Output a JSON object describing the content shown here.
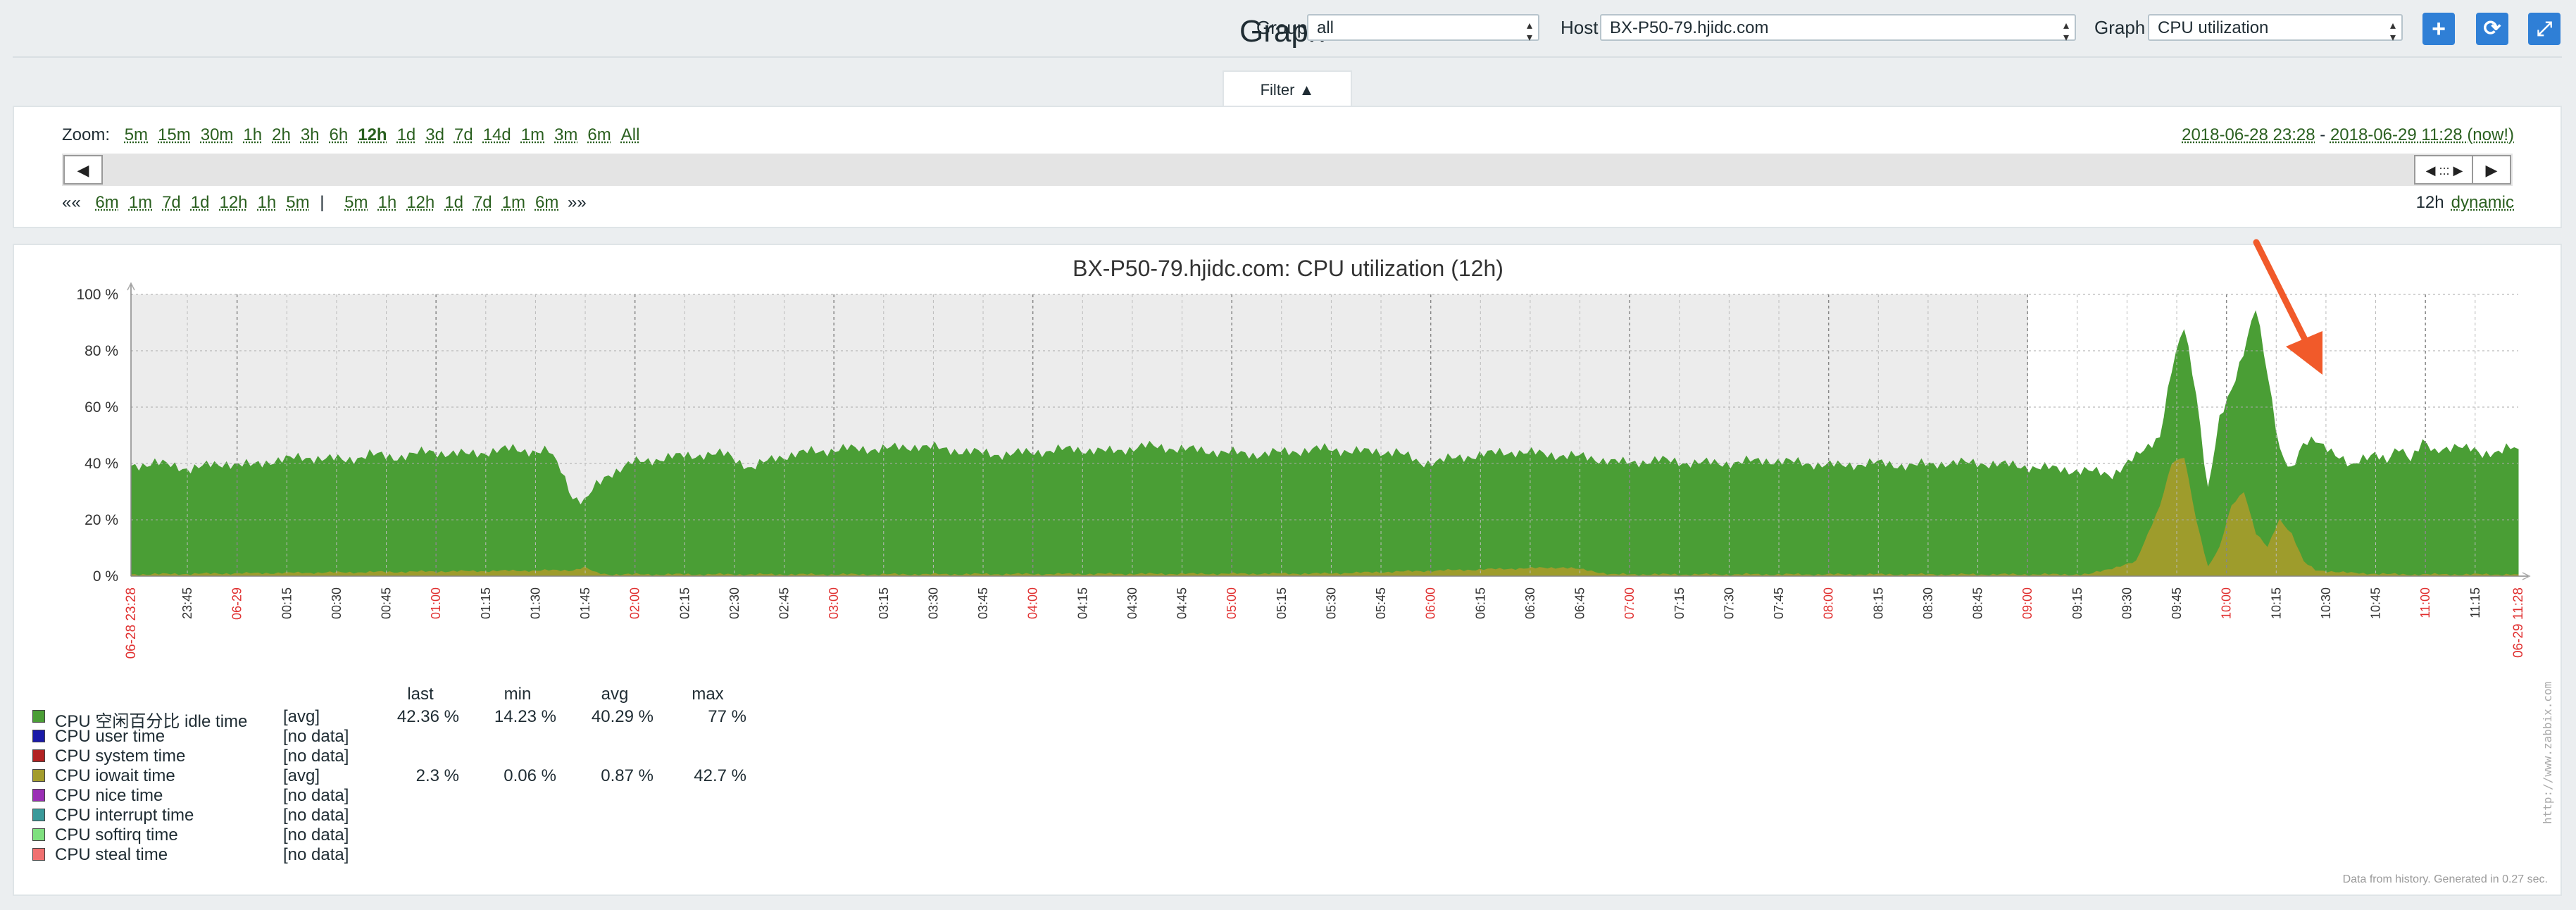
{
  "header": {
    "title": "Graph",
    "group_label": "Group",
    "group_value": "all",
    "host_label": "Host",
    "host_value": "BX-P50-79.hjidc.com",
    "graph_label": "Graph",
    "graph_value": "CPU utilization"
  },
  "filter": {
    "tab_label": "Filter ▲",
    "zoom_label": "Zoom:",
    "zoom_options": [
      "5m",
      "15m",
      "30m",
      "1h",
      "2h",
      "3h",
      "6h",
      "12h",
      "1d",
      "3d",
      "7d",
      "14d",
      "1m",
      "3m",
      "6m",
      "All"
    ],
    "zoom_active": "12h",
    "period_from": "2018-06-28 23:28",
    "period_sep": " - ",
    "period_to": "2018-06-29 11:28 (now!)",
    "nav_back_label": "««",
    "nav_back_options": [
      "6m",
      "1m",
      "7d",
      "1d",
      "12h",
      "1h",
      "5m"
    ],
    "nav_separator": "|",
    "nav_fwd_options": [
      "5m",
      "1h",
      "12h",
      "1d",
      "7d",
      "1m",
      "6m"
    ],
    "nav_fwd_label": "»»",
    "period_length": "12h",
    "period_mode": "dynamic",
    "scroll_left_label": "◀",
    "scroll_right_label": "▶",
    "scroll_handle_label": "◀ ::: ▶"
  },
  "chart_data": {
    "type": "area",
    "title": "BX-P50-79.hjidc.com: CPU utilization (12h)",
    "ylim": [
      0,
      100
    ],
    "y_ticks": [
      "100 %",
      "80 %",
      "60 %",
      "40 %",
      "20 %",
      "0 %"
    ],
    "x_start_label": "06-28 23:28",
    "x_end_label": "06-29 11:28",
    "x_tick_labels": [
      "23:45",
      "06-29",
      "00:15",
      "00:30",
      "00:45",
      "01:00",
      "01:15",
      "01:30",
      "01:45",
      "02:00",
      "02:15",
      "02:30",
      "02:45",
      "03:00",
      "03:15",
      "03:30",
      "03:45",
      "04:00",
      "04:15",
      "04:30",
      "04:45",
      "05:00",
      "05:15",
      "05:30",
      "05:45",
      "06:00",
      "06:15",
      "06:30",
      "06:45",
      "07:00",
      "07:15",
      "07:30",
      "07:45",
      "08:00",
      "08:15",
      "08:30",
      "08:45",
      "09:00",
      "09:15",
      "09:30",
      "09:45",
      "10:00",
      "10:15",
      "10:30",
      "10:45",
      "11:00",
      "11:15"
    ],
    "x_tick_red": [
      "06-29",
      "01:00",
      "02:00",
      "03:00",
      "04:00",
      "05:00",
      "06:00",
      "07:00",
      "08:00",
      "09:00",
      "10:00",
      "11:00"
    ],
    "series": [
      {
        "name": "CPU 空闲百分比 idle time",
        "color": "#4a9e35",
        "points": [
          [
            0,
            39
          ],
          [
            2,
            40
          ],
          [
            5,
            38
          ],
          [
            8,
            40
          ],
          [
            10,
            39
          ],
          [
            12,
            41
          ],
          [
            15,
            42
          ],
          [
            18,
            41
          ],
          [
            20,
            43
          ],
          [
            22,
            42
          ],
          [
            25,
            44
          ],
          [
            28,
            43
          ],
          [
            30,
            44
          ],
          [
            32,
            45
          ],
          [
            34,
            44
          ],
          [
            35,
            44
          ],
          [
            36,
            38
          ],
          [
            37,
            28
          ],
          [
            38,
            26
          ],
          [
            39,
            32
          ],
          [
            40,
            36
          ],
          [
            42,
            40
          ],
          [
            45,
            42
          ],
          [
            48,
            43
          ],
          [
            50,
            43
          ],
          [
            52,
            38
          ],
          [
            54,
            42
          ],
          [
            57,
            44
          ],
          [
            60,
            45
          ],
          [
            63,
            45
          ],
          [
            66,
            46
          ],
          [
            70,
            44
          ],
          [
            73,
            43
          ],
          [
            76,
            44
          ],
          [
            79,
            45
          ],
          [
            82,
            44
          ],
          [
            85,
            46
          ],
          [
            88,
            45
          ],
          [
            91,
            44
          ],
          [
            94,
            43
          ],
          [
            97,
            44
          ],
          [
            100,
            45
          ],
          [
            103,
            44
          ],
          [
            106,
            44
          ],
          [
            108,
            40
          ],
          [
            110,
            41
          ],
          [
            113,
            43
          ],
          [
            116,
            44
          ],
          [
            119,
            43
          ],
          [
            122,
            42
          ],
          [
            125,
            40
          ],
          [
            128,
            41
          ],
          [
            131,
            40
          ],
          [
            134,
            40
          ],
          [
            137,
            41
          ],
          [
            140,
            40
          ],
          [
            143,
            39
          ],
          [
            146,
            40
          ],
          [
            149,
            39
          ],
          [
            152,
            40
          ],
          [
            155,
            40
          ],
          [
            158,
            39
          ],
          [
            161,
            38
          ],
          [
            164,
            37
          ],
          [
            166,
            36
          ],
          [
            168,
            42
          ],
          [
            170,
            50
          ],
          [
            171,
            73
          ],
          [
            172,
            88
          ],
          [
            173,
            65
          ],
          [
            174,
            30
          ],
          [
            175,
            55
          ],
          [
            176,
            66
          ],
          [
            177,
            80
          ],
          [
            178,
            95
          ],
          [
            179,
            70
          ],
          [
            180,
            45
          ],
          [
            181,
            38
          ],
          [
            182,
            46
          ],
          [
            183,
            48
          ],
          [
            184,
            46
          ],
          [
            185,
            42
          ],
          [
            186,
            38
          ],
          [
            187,
            42
          ],
          [
            188,
            44
          ],
          [
            189,
            40
          ],
          [
            190,
            45
          ],
          [
            191,
            42
          ],
          [
            192,
            48
          ],
          [
            193,
            43
          ],
          [
            194,
            45
          ],
          [
            195,
            47
          ],
          [
            196,
            45
          ],
          [
            197,
            42
          ],
          [
            198,
            44
          ],
          [
            199,
            46
          ],
          [
            200,
            45
          ]
        ]
      },
      {
        "name": "CPU iowait time",
        "color": "#a39c2c",
        "points": [
          [
            0,
            0.5
          ],
          [
            37,
            2
          ],
          [
            38,
            3
          ],
          [
            39,
            1
          ],
          [
            40,
            0.5
          ],
          [
            60,
            0.5
          ],
          [
            100,
            0.8
          ],
          [
            120,
            3
          ],
          [
            122,
            2
          ],
          [
            124,
            0.5
          ],
          [
            164,
            0.5
          ],
          [
            168,
            5
          ],
          [
            170,
            25
          ],
          [
            171,
            40
          ],
          [
            172,
            42
          ],
          [
            173,
            20
          ],
          [
            174,
            3
          ],
          [
            175,
            10
          ],
          [
            176,
            25
          ],
          [
            177,
            30
          ],
          [
            178,
            15
          ],
          [
            179,
            10
          ],
          [
            180,
            20
          ],
          [
            181,
            15
          ],
          [
            182,
            5
          ],
          [
            183,
            2
          ],
          [
            186,
            1
          ],
          [
            190,
            0.5
          ],
          [
            200,
            0.5
          ]
        ]
      }
    ]
  },
  "legend": {
    "headers": {
      "last": "last",
      "min": "min",
      "avg": "avg",
      "max": "max"
    },
    "items": [
      {
        "name": "CPU 空闲百分比 idle time",
        "func": "[avg]",
        "last": "42.36 %",
        "min": "14.23 %",
        "avg": "40.29 %",
        "max": "77 %",
        "color": "#4a9e35"
      },
      {
        "name": "CPU user time",
        "func": "[no data]",
        "color": "#1a1aa8"
      },
      {
        "name": "CPU system time",
        "func": "[no data]",
        "color": "#b22222"
      },
      {
        "name": "CPU iowait time",
        "func": "[avg]",
        "last": "2.3 %",
        "min": "0.06 %",
        "avg": "0.87 %",
        "max": "42.7 %",
        "color": "#a39c2c"
      },
      {
        "name": "CPU nice time",
        "func": "[no data]",
        "color": "#9b2fb5"
      },
      {
        "name": "CPU interrupt time",
        "func": "[no data]",
        "color": "#3a9a9a"
      },
      {
        "name": "CPU softirq time",
        "func": "[no data]",
        "color": "#7fe07f"
      },
      {
        "name": "CPU steal time",
        "func": "[no data]",
        "color": "#f07070"
      }
    ]
  },
  "watermark": "http://www.zabbix.com",
  "footer_note": "Data from history. Generated in 0.27 sec."
}
